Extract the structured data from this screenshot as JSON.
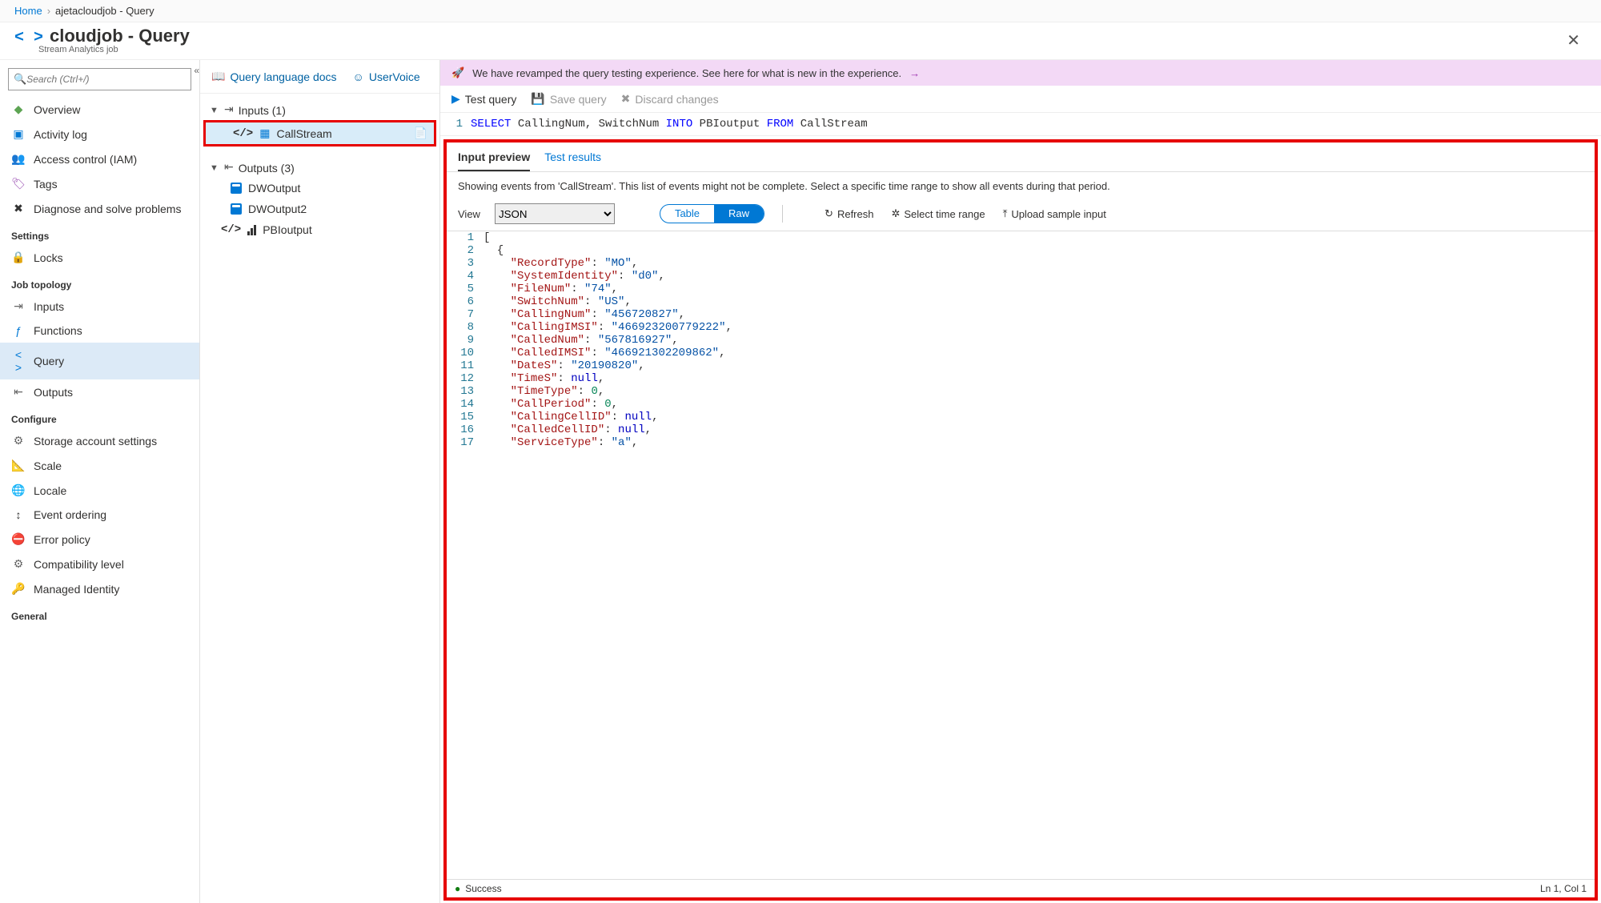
{
  "breadcrumb": {
    "home": "Home",
    "current": "ajetacloudjob - Query"
  },
  "header": {
    "title": "cloudjob - Query",
    "subtitle": "Stream Analytics job"
  },
  "search": {
    "placeholder": "Search (Ctrl+/)"
  },
  "nav": {
    "top": [
      "Overview",
      "Activity log",
      "Access control (IAM)",
      "Tags",
      "Diagnose and solve problems"
    ],
    "sections": [
      {
        "title": "Settings",
        "items": [
          "Locks"
        ]
      },
      {
        "title": "Job topology",
        "items": [
          "Inputs",
          "Functions",
          "Query",
          "Outputs"
        ],
        "selected": "Query"
      },
      {
        "title": "Configure",
        "items": [
          "Storage account settings",
          "Scale",
          "Locale",
          "Event ordering",
          "Error policy",
          "Compatibility level",
          "Managed Identity"
        ]
      },
      {
        "title": "General",
        "items": []
      }
    ]
  },
  "toplinks": {
    "docs": "Query language docs",
    "uservoice": "UserVoice"
  },
  "tree": {
    "inputs_label": "Inputs (1)",
    "inputs": [
      "CallStream"
    ],
    "outputs_label": "Outputs (3)",
    "outputs": [
      "DWOutput",
      "DWOutput2",
      "PBIoutput"
    ]
  },
  "banner": "We have revamped the query testing experience. See here for what is new in the experience.",
  "toolbar": {
    "test": "Test query",
    "save": "Save query",
    "discard": "Discard changes"
  },
  "editor": {
    "line_no": "1",
    "tokens": [
      {
        "t": "SELECT",
        "c": "kw-blue"
      },
      {
        "t": " CallingNum, SwitchNum ",
        "c": ""
      },
      {
        "t": "INTO",
        "c": "kw-blue"
      },
      {
        "t": " PBIoutput ",
        "c": ""
      },
      {
        "t": "FROM",
        "c": "kw-blue"
      },
      {
        "t": " CallStream",
        "c": ""
      }
    ]
  },
  "preview": {
    "tabs": {
      "input": "Input preview",
      "results": "Test results"
    },
    "info": "Showing events from 'CallStream'. This list of events might not be complete. Select a specific time range to show all events during that period.",
    "view_label": "View",
    "view_select": "JSON",
    "toggle": {
      "table": "Table",
      "raw": "Raw"
    },
    "actions": {
      "refresh": "Refresh",
      "timerange": "Select time range",
      "upload": "Upload sample input"
    }
  },
  "json_lines": [
    {
      "n": 1,
      "segs": [
        {
          "t": "[",
          "c": ""
        }
      ]
    },
    {
      "n": 2,
      "segs": [
        {
          "t": "  {",
          "c": ""
        }
      ]
    },
    {
      "n": 3,
      "segs": [
        {
          "t": "    ",
          "c": ""
        },
        {
          "t": "\"RecordType\"",
          "c": "jkey"
        },
        {
          "t": ": ",
          "c": ""
        },
        {
          "t": "\"MO\"",
          "c": "jstr"
        },
        {
          "t": ",",
          "c": ""
        }
      ]
    },
    {
      "n": 4,
      "segs": [
        {
          "t": "    ",
          "c": ""
        },
        {
          "t": "\"SystemIdentity\"",
          "c": "jkey"
        },
        {
          "t": ": ",
          "c": ""
        },
        {
          "t": "\"d0\"",
          "c": "jstr"
        },
        {
          "t": ",",
          "c": ""
        }
      ]
    },
    {
      "n": 5,
      "segs": [
        {
          "t": "    ",
          "c": ""
        },
        {
          "t": "\"FileNum\"",
          "c": "jkey"
        },
        {
          "t": ": ",
          "c": ""
        },
        {
          "t": "\"74\"",
          "c": "jstr"
        },
        {
          "t": ",",
          "c": ""
        }
      ]
    },
    {
      "n": 6,
      "segs": [
        {
          "t": "    ",
          "c": ""
        },
        {
          "t": "\"SwitchNum\"",
          "c": "jkey"
        },
        {
          "t": ": ",
          "c": ""
        },
        {
          "t": "\"US\"",
          "c": "jstr"
        },
        {
          "t": ",",
          "c": ""
        }
      ]
    },
    {
      "n": 7,
      "segs": [
        {
          "t": "    ",
          "c": ""
        },
        {
          "t": "\"CallingNum\"",
          "c": "jkey"
        },
        {
          "t": ": ",
          "c": ""
        },
        {
          "t": "\"456720827\"",
          "c": "jstr"
        },
        {
          "t": ",",
          "c": ""
        }
      ]
    },
    {
      "n": 8,
      "segs": [
        {
          "t": "    ",
          "c": ""
        },
        {
          "t": "\"CallingIMSI\"",
          "c": "jkey"
        },
        {
          "t": ": ",
          "c": ""
        },
        {
          "t": "\"466923200779222\"",
          "c": "jstr"
        },
        {
          "t": ",",
          "c": ""
        }
      ]
    },
    {
      "n": 9,
      "segs": [
        {
          "t": "    ",
          "c": ""
        },
        {
          "t": "\"CalledNum\"",
          "c": "jkey"
        },
        {
          "t": ": ",
          "c": ""
        },
        {
          "t": "\"567816927\"",
          "c": "jstr"
        },
        {
          "t": ",",
          "c": ""
        }
      ]
    },
    {
      "n": 10,
      "segs": [
        {
          "t": "    ",
          "c": ""
        },
        {
          "t": "\"CalledIMSI\"",
          "c": "jkey"
        },
        {
          "t": ": ",
          "c": ""
        },
        {
          "t": "\"466921302209862\"",
          "c": "jstr"
        },
        {
          "t": ",",
          "c": ""
        }
      ]
    },
    {
      "n": 11,
      "segs": [
        {
          "t": "    ",
          "c": ""
        },
        {
          "t": "\"DateS\"",
          "c": "jkey"
        },
        {
          "t": ": ",
          "c": ""
        },
        {
          "t": "\"20190820\"",
          "c": "jstr"
        },
        {
          "t": ",",
          "c": ""
        }
      ]
    },
    {
      "n": 12,
      "segs": [
        {
          "t": "    ",
          "c": ""
        },
        {
          "t": "\"TimeS\"",
          "c": "jkey"
        },
        {
          "t": ": ",
          "c": ""
        },
        {
          "t": "null",
          "c": "jnull"
        },
        {
          "t": ",",
          "c": ""
        }
      ]
    },
    {
      "n": 13,
      "segs": [
        {
          "t": "    ",
          "c": ""
        },
        {
          "t": "\"TimeType\"",
          "c": "jkey"
        },
        {
          "t": ": ",
          "c": ""
        },
        {
          "t": "0",
          "c": "jnum"
        },
        {
          "t": ",",
          "c": ""
        }
      ]
    },
    {
      "n": 14,
      "segs": [
        {
          "t": "    ",
          "c": ""
        },
        {
          "t": "\"CallPeriod\"",
          "c": "jkey"
        },
        {
          "t": ": ",
          "c": ""
        },
        {
          "t": "0",
          "c": "jnum"
        },
        {
          "t": ",",
          "c": ""
        }
      ]
    },
    {
      "n": 15,
      "segs": [
        {
          "t": "    ",
          "c": ""
        },
        {
          "t": "\"CallingCellID\"",
          "c": "jkey"
        },
        {
          "t": ": ",
          "c": ""
        },
        {
          "t": "null",
          "c": "jnull"
        },
        {
          "t": ",",
          "c": ""
        }
      ]
    },
    {
      "n": 16,
      "segs": [
        {
          "t": "    ",
          "c": ""
        },
        {
          "t": "\"CalledCellID\"",
          "c": "jkey"
        },
        {
          "t": ": ",
          "c": ""
        },
        {
          "t": "null",
          "c": "jnull"
        },
        {
          "t": ",",
          "c": ""
        }
      ]
    },
    {
      "n": 17,
      "segs": [
        {
          "t": "    ",
          "c": ""
        },
        {
          "t": "\"ServiceType\"",
          "c": "jkey"
        },
        {
          "t": ": ",
          "c": ""
        },
        {
          "t": "\"a\"",
          "c": "jstr"
        },
        {
          "t": ",",
          "c": ""
        }
      ]
    }
  ],
  "status": {
    "text": "Success",
    "position": "Ln 1, Col 1"
  }
}
